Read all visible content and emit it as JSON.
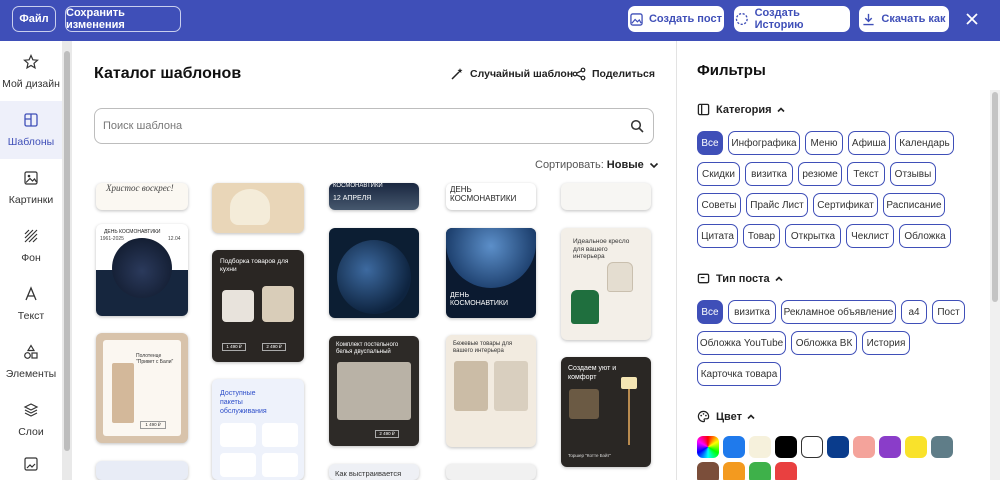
{
  "topbar": {
    "file": "Файл",
    "save": "Сохранить изменения",
    "create_post": "Создать пост",
    "create_story": "Создать Историю",
    "download": "Скачать как"
  },
  "sidebar": {
    "items": [
      {
        "label": "Мой дизайн"
      },
      {
        "label": "Шаблоны"
      },
      {
        "label": "Картинки"
      },
      {
        "label": "Фон"
      },
      {
        "label": "Текст"
      },
      {
        "label": "Элементы"
      },
      {
        "label": "Слои"
      }
    ]
  },
  "catalog": {
    "title": "Каталог шаблонов",
    "random": "Случайный шаблон",
    "share": "Поделиться",
    "search_placeholder": "Поиск шаблона",
    "sort_label": "Сортировать:",
    "sort_value": "Новые"
  },
  "templates": {
    "easter": "Христос воскрес!",
    "cosmo_top": "КОСМОНАВТИКИ",
    "april_top": "12 АПРЕЛЯ",
    "cosmo_day": "ДЕНЬ КОСМОНАВТИКИ",
    "years": "1961-2025",
    "date_short": "12.04",
    "kitchen": "Подборка товаров для кухни",
    "chair": "Идеальное кресло для вашего интерьера",
    "towel": "Полотенце \"Привет с Бали\"",
    "services": "Доступные пакеты обслуживания",
    "bedding": "Комплект постельного белья двуспальный",
    "beige": "Бежевые товары для вашего интерьера",
    "cozy": "Создаем уют и комфорт",
    "build": "Как выстраивается",
    "day_cosmo_a": "ДЕНЬ",
    "day_cosmo_b": "КОСМОНАВТИКИ",
    "price": "1 490 ₽",
    "price2": "2 490 ₽",
    "lamp": "Торшер \"Котте Бэйт\""
  },
  "filters": {
    "title": "Фильтры",
    "category_title": "Категория",
    "categories": [
      "Все",
      "Инфографика",
      "Меню",
      "Афиша",
      "Календарь",
      "Скидки",
      "визитка",
      "резюме",
      "Текст",
      "Отзывы",
      "Советы",
      "Прайс Лист",
      "Сертификат",
      "Расписание",
      "Цитата",
      "Товар",
      "Открытка",
      "Чеклист",
      "Обложка"
    ],
    "post_type_title": "Тип поста",
    "post_types": [
      "Все",
      "визитка",
      "Рекламное объявление",
      "а4",
      "Пост",
      "Обложка YouTube",
      "Обложка ВК",
      "История",
      "Карточка товара"
    ],
    "color_title": "Цвет",
    "colors": [
      "rainbow",
      "#1f7aec",
      "#f6f1dc",
      "#000000",
      "#ffffff",
      "#0a3c8c",
      "#f4a39b",
      "#8a3dc9",
      "#f9e22b",
      "#5f7d88",
      "#7b4e3a",
      "#f39a1f",
      "#3eb14a",
      "#e94040"
    ]
  }
}
